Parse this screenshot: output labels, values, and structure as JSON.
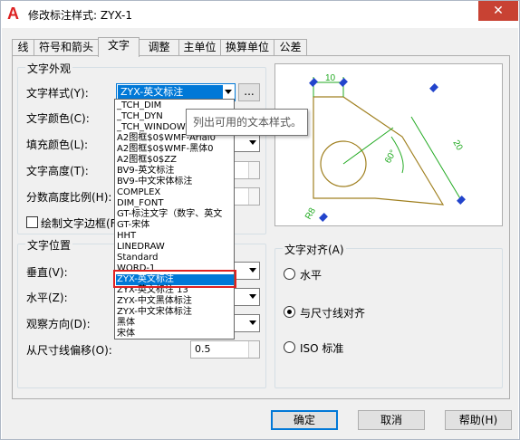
{
  "window": {
    "title": "修改标注样式: ZYX-1",
    "close": "✕"
  },
  "tabs": [
    "线",
    "符号和箭头",
    "文字",
    "调整",
    "主单位",
    "换算单位",
    "公差"
  ],
  "appearance": {
    "title": "文字外观",
    "style_label": "文字样式(Y):",
    "style_value": "ZYX-英文标注",
    "style_btn": "...",
    "color_label": "文字颜色(C):",
    "fill_label": "填充颜色(L):",
    "height_label": "文字高度(T):",
    "fraction_label": "分数高度比例(H):",
    "frame_label": "绘制文字边框(F)"
  },
  "position": {
    "title": "文字位置",
    "vertical_label": "垂直(V):",
    "horizontal_label": "水平(Z):",
    "view_label": "观察方向(D):",
    "offset_label": "从尺寸线偏移(O):",
    "offset_value": "0.5"
  },
  "alignment": {
    "title": "文字对齐(A)",
    "options": [
      "水平",
      "与尺寸线对齐",
      "ISO 标准"
    ],
    "selected": 1
  },
  "tooltip": "列出可用的文本样式。",
  "dropdown": {
    "items": [
      "_TCH_DIM",
      "_TCH_DYN",
      "_TCH_WINDOW",
      "A2图框$0$WMF-Arial0",
      "A2图框$0$WMF-黑体0",
      "A2图框$0$ZZ",
      "BV9-英文标注",
      "BV9-中文宋体标注",
      "COMPLEX",
      "DIM_FONT",
      "GT-标注文字（数字、英文",
      "GT-宋体",
      "HHT",
      "LINEDRAW",
      "Standard",
      "WORD-1",
      "ZYX-英文标注",
      "ZYX-英文标注 13",
      "ZYX-中文黑体标注",
      "ZYX-中文宋体标注",
      "黑体",
      "宋体"
    ],
    "highlighted": 16
  },
  "preview": {
    "dim_top": "10",
    "dim_right": "20",
    "dim_angle": "60°",
    "dim_radius": "R8"
  },
  "buttons": {
    "ok": "确定",
    "cancel": "取消",
    "help": "帮助(H)"
  },
  "colors": {
    "accent": "#0078d7",
    "highlight_border": "#e02020",
    "dim_line": "#22aa22",
    "geometry": "#a08020"
  }
}
